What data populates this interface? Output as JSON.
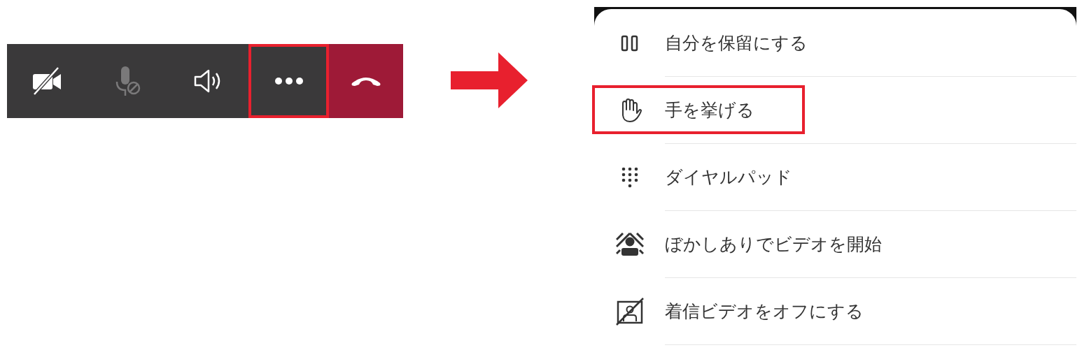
{
  "call_toolbar": {
    "buttons": [
      {
        "kind": "camera-off",
        "disabled": false,
        "highlighted": false
      },
      {
        "kind": "mic-off",
        "disabled": true,
        "highlighted": false
      },
      {
        "kind": "speaker",
        "disabled": false,
        "highlighted": false
      },
      {
        "kind": "more",
        "disabled": false,
        "highlighted": true
      },
      {
        "kind": "hang-up",
        "disabled": false,
        "highlighted": false
      }
    ]
  },
  "menu": {
    "items": [
      {
        "kind": "hold",
        "label": "自分を保留にする",
        "highlighted": false
      },
      {
        "kind": "raise-hand",
        "label": "手を挙げる",
        "highlighted": true
      },
      {
        "kind": "dialpad",
        "label": "ダイヤルパッド",
        "highlighted": false
      },
      {
        "kind": "blur-video",
        "label": "ぼかしありでビデオを開始",
        "highlighted": false
      },
      {
        "kind": "video-off",
        "label": "着信ビデオをオフにする",
        "highlighted": false
      }
    ]
  }
}
